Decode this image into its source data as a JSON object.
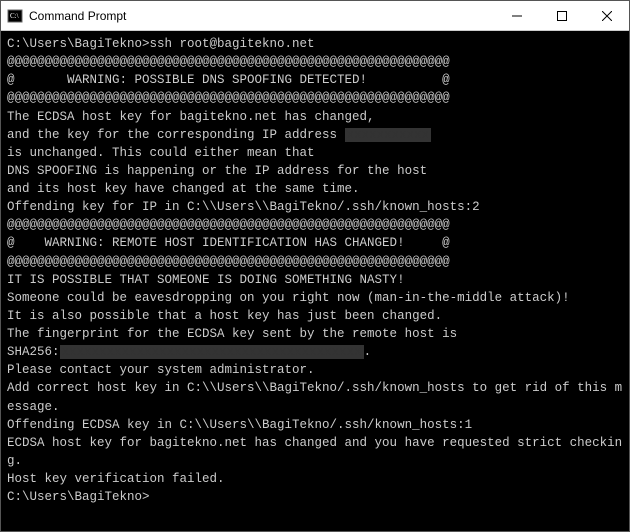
{
  "window": {
    "title": "Command Prompt"
  },
  "terminal": {
    "prompt1": "C:\\Users\\BagiTekno>",
    "command1": "ssh root@bagitekno.net",
    "at_line1": "@@@@@@@@@@@@@@@@@@@@@@@@@@@@@@@@@@@@@@@@@@@@@@@@@@@@@@@@@@@",
    "warn1": "@       WARNING: POSSIBLE DNS SPOOFING DETECTED!          @",
    "at_line2": "@@@@@@@@@@@@@@@@@@@@@@@@@@@@@@@@@@@@@@@@@@@@@@@@@@@@@@@@@@@",
    "l1": "The ECDSA host key for bagitekno.net has changed,",
    "l2a": "and the key for the corresponding IP address ",
    "l2b_redacted": "xxxxxxxxxxx",
    "l3": "is unchanged. This could either mean that",
    "l4": "DNS SPOOFING is happening or the IP address for the host",
    "l5": "and its host key have changed at the same time.",
    "l6": "Offending key for IP in C:\\\\Users\\\\BagiTekno/.ssh/known_hosts:2",
    "at_line3": "@@@@@@@@@@@@@@@@@@@@@@@@@@@@@@@@@@@@@@@@@@@@@@@@@@@@@@@@@@@",
    "warn2": "@    WARNING: REMOTE HOST IDENTIFICATION HAS CHANGED!     @",
    "at_line4": "@@@@@@@@@@@@@@@@@@@@@@@@@@@@@@@@@@@@@@@@@@@@@@@@@@@@@@@@@@@",
    "l7": "IT IS POSSIBLE THAT SOMEONE IS DOING SOMETHING NASTY!",
    "l8": "Someone could be eavesdropping on you right now (man-in-the-middle attack)!",
    "l9": "It is also possible that a host key has just been changed.",
    "l10": "The fingerprint for the ECDSA key sent by the remote host is",
    "l11a": "SHA256:",
    "l11b_redacted": "xxxxxxxxxxxxxxxxxxxxxxxxxxxxxxxxxxxxxxxx",
    "l11c": ".",
    "l12": "Please contact your system administrator.",
    "l13": "Add correct host key in C:\\\\Users\\\\BagiTekno/.ssh/known_hosts to get rid of this message.",
    "l14": "Offending ECDSA key in C:\\\\Users\\\\BagiTekno/.ssh/known_hosts:1",
    "l15": "ECDSA host key for bagitekno.net has changed and you have requested strict checking.",
    "l16": "Host key verification failed.",
    "blank": "",
    "prompt2": "C:\\Users\\BagiTekno>"
  }
}
